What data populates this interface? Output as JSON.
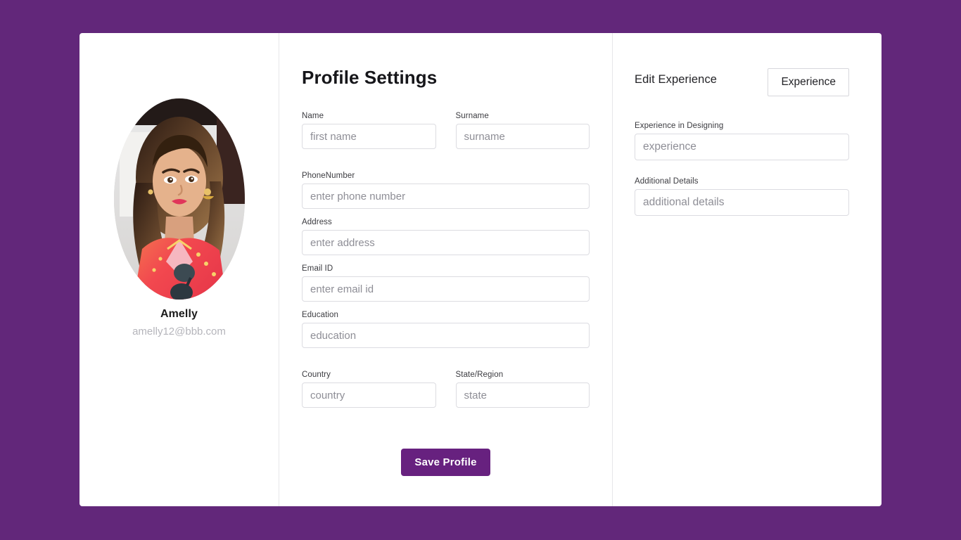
{
  "theme": {
    "background": "#62277a",
    "card_background": "#ffffff",
    "accent": "#67217f",
    "divider": "#e7e7e9",
    "input_border": "#dcdce1",
    "placeholder": "#8e8e96",
    "muted_text": "#b5b5bb"
  },
  "profile": {
    "avatar_icon": "user-photo-portrait",
    "name": "Amelly",
    "email": "amelly12@bbb.com"
  },
  "main": {
    "title": "Profile Settings",
    "fields": {
      "name": {
        "label": "Name",
        "placeholder": "first name",
        "value": ""
      },
      "surname": {
        "label": "Surname",
        "placeholder": "surname",
        "value": ""
      },
      "phone": {
        "label": "PhoneNumber",
        "placeholder": "enter phone number",
        "value": ""
      },
      "address": {
        "label": "Address",
        "placeholder": "enter address",
        "value": ""
      },
      "email": {
        "label": "Email ID",
        "placeholder": "enter email id",
        "value": ""
      },
      "education": {
        "label": "Education",
        "placeholder": "education",
        "value": ""
      },
      "country": {
        "label": "Country",
        "placeholder": "country",
        "value": ""
      },
      "state": {
        "label": "State/Region",
        "placeholder": "state",
        "value": ""
      }
    },
    "save_label": "Save Profile"
  },
  "experience": {
    "title": "Edit Experience",
    "button_label": "Experience",
    "fields": {
      "designing": {
        "label": "Experience in Designing",
        "placeholder": "experience",
        "value": ""
      },
      "additional": {
        "label": "Additional Details",
        "placeholder": "additional details",
        "value": ""
      }
    }
  }
}
